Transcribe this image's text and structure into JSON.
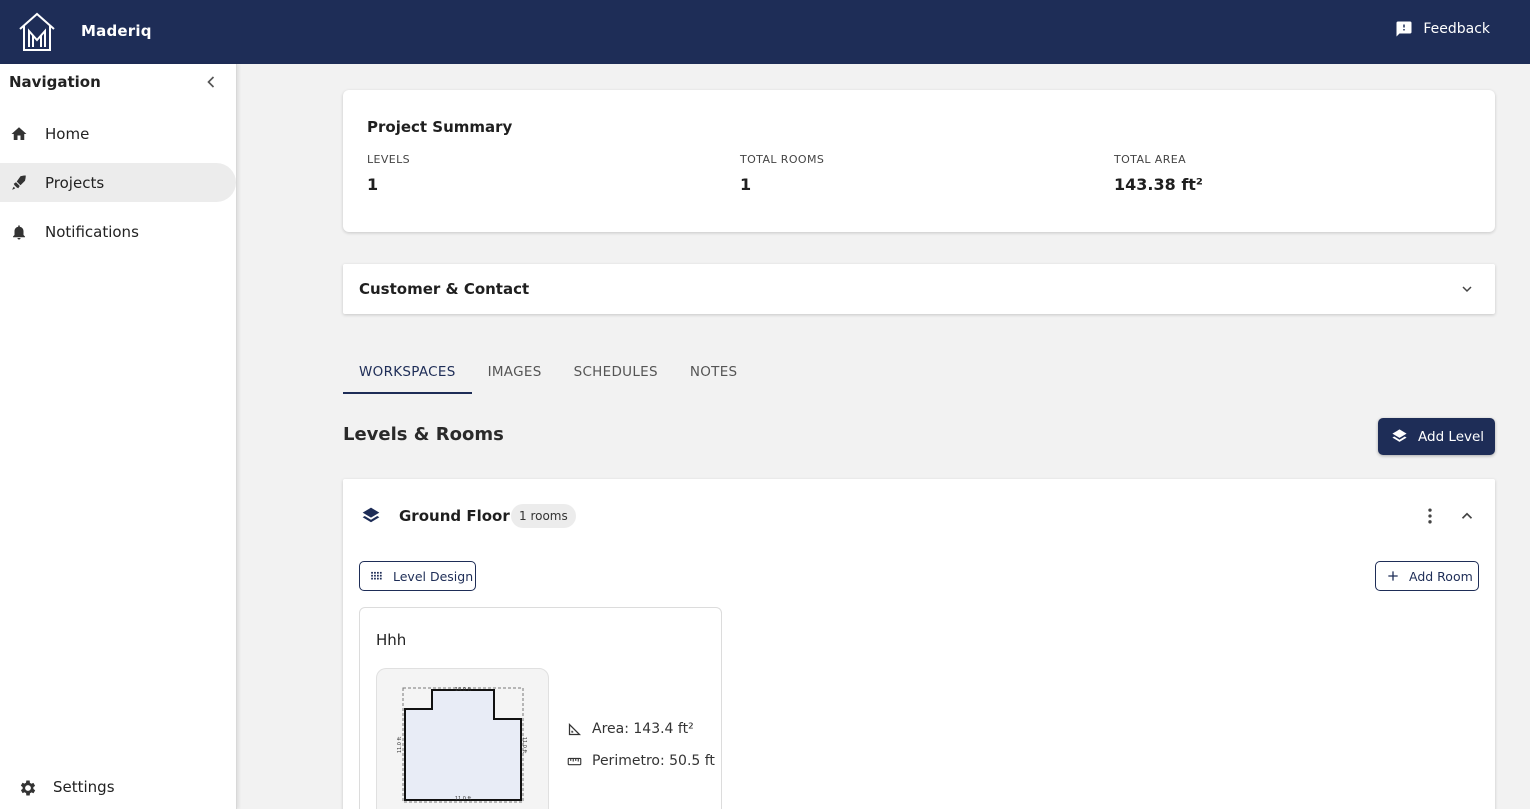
{
  "app": {
    "title": "Maderiq",
    "feedback_label": "Feedback"
  },
  "sidebar": {
    "header": "Navigation",
    "items": [
      {
        "label": "Home",
        "icon": "home-icon",
        "active": false
      },
      {
        "label": "Projects",
        "icon": "rocket-icon",
        "active": true
      },
      {
        "label": "Notifications",
        "icon": "bell-icon",
        "active": false
      }
    ],
    "settings_label": "Settings"
  },
  "summary": {
    "title": "Project Summary",
    "stats": [
      {
        "label": "LEVELS",
        "value": "1"
      },
      {
        "label": "TOTAL ROOMS",
        "value": "1"
      },
      {
        "label": "TOTAL AREA",
        "value": "143.38 ft²"
      }
    ]
  },
  "customer": {
    "title": "Customer & Contact"
  },
  "tabs": [
    {
      "label": "WORKSPACES",
      "active": true
    },
    {
      "label": "IMAGES",
      "active": false
    },
    {
      "label": "SCHEDULES",
      "active": false
    },
    {
      "label": "NOTES",
      "active": false
    }
  ],
  "levels_section": {
    "title": "Levels & Rooms",
    "add_level_label": "Add Level"
  },
  "level": {
    "name": "Ground Floor",
    "rooms_count": "1 rooms",
    "level_design_label": "Level Design",
    "add_room_label": "Add Room",
    "room": {
      "name": "Hhh",
      "area": "Area: 143.4 ft²",
      "perimeter": "Perimetro: 50.5 ft",
      "dims": {
        "top": "14.0 ft",
        "left": "11.0 ft",
        "right": "11.0 ft",
        "bottom": "11.0 ft"
      }
    }
  },
  "colors": {
    "brand": "#1e2d57",
    "background": "#f2f2f2",
    "room_fill": "#e8ecf6"
  }
}
